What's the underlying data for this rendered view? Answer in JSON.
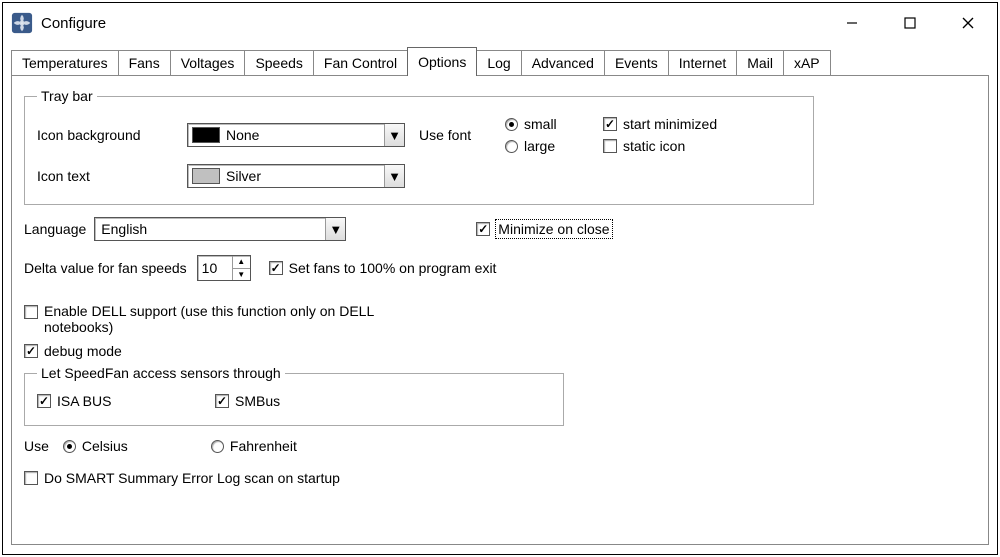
{
  "window": {
    "title": "Configure"
  },
  "tabs": [
    "Temperatures",
    "Fans",
    "Voltages",
    "Speeds",
    "Fan Control",
    "Options",
    "Log",
    "Advanced",
    "Events",
    "Internet",
    "Mail",
    "xAP"
  ],
  "traybar": {
    "legend": "Tray bar",
    "icon_bg_label": "Icon background",
    "icon_bg_value": "None",
    "icon_text_label": "Icon text",
    "icon_text_value": "Silver",
    "use_font_label": "Use font",
    "small_label": "small",
    "large_label": "large",
    "start_min_label": "start minimized",
    "static_icon_label": "static icon"
  },
  "language_label": "Language",
  "language_value": "English",
  "min_on_close_label": "Minimize on close",
  "delta_label": "Delta value for fan speeds",
  "delta_value": "10",
  "set_fans_exit_label": "Set fans to 100% on program exit",
  "dell_label": "Enable DELL support (use this function only on DELL notebooks)",
  "debug_label": "debug mode",
  "sensors": {
    "legend": "Let SpeedFan access sensors through",
    "isa_label": "ISA BUS",
    "smbus_label": "SMBus"
  },
  "use_label": "Use",
  "celsius_label": "Celsius",
  "fahrenheit_label": "Fahrenheit",
  "smart_label": "Do SMART Summary Error Log scan on startup"
}
